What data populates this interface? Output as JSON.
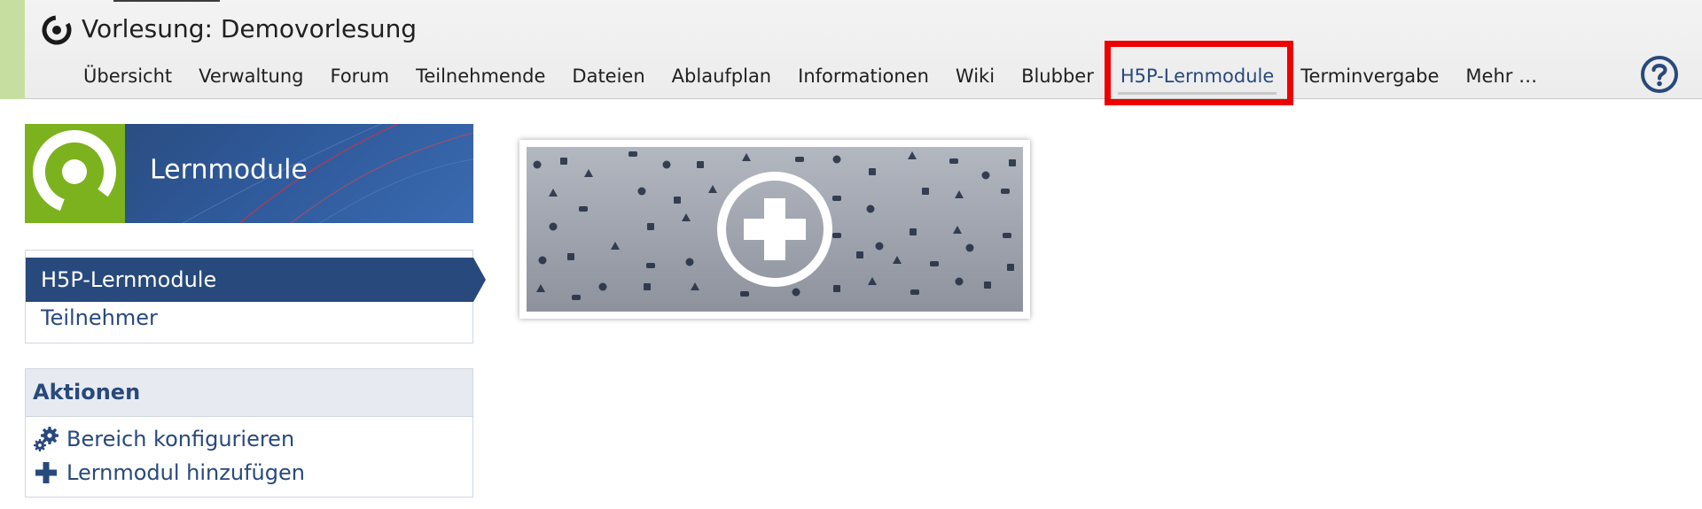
{
  "header": {
    "course_title": "Vorlesung: Demovorlesung",
    "nav": [
      {
        "label": "Übersicht"
      },
      {
        "label": "Verwaltung"
      },
      {
        "label": "Forum"
      },
      {
        "label": "Teilnehmende"
      },
      {
        "label": "Dateien"
      },
      {
        "label": "Ablaufplan"
      },
      {
        "label": "Informationen"
      },
      {
        "label": "Wiki"
      },
      {
        "label": "Blubber"
      },
      {
        "label": "H5P-Lernmodule",
        "active": true
      },
      {
        "label": "Terminvergabe"
      },
      {
        "label": "Mehr …"
      }
    ],
    "help_icon": "help-circle-icon"
  },
  "sidebar": {
    "banner_title": "Lernmodule",
    "nav_items": [
      "H5P-Lernmodule",
      "Teilnehmer"
    ],
    "actions": {
      "title": "Aktionen",
      "items": [
        {
          "label": "Bereich konfigurieren",
          "icon": "gears-icon"
        },
        {
          "label": "Lernmodul hinzufügen",
          "icon": "plus-icon"
        }
      ]
    }
  },
  "main": {
    "add_tile_icon": "add-circle-icon"
  },
  "colors": {
    "accent_blue": "#28497c",
    "logo_green": "#7bb21e",
    "highlight_red": "#ee0000",
    "header_strip": "#c6dfa0"
  }
}
